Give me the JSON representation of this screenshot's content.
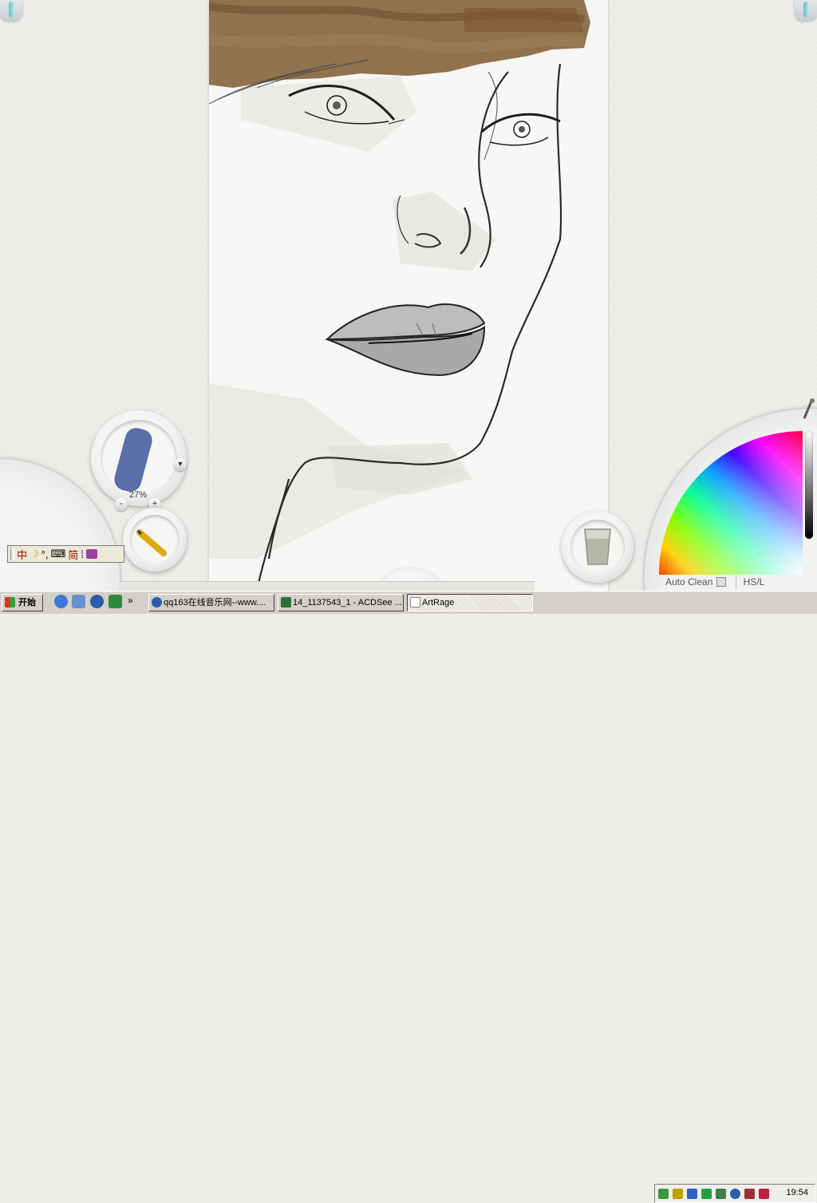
{
  "app": {
    "name": "ArtRage"
  },
  "tools": {
    "brush_size": "27%",
    "minus_label": "-",
    "plus_label": "+"
  },
  "color_picker": {
    "auto_clean_label": "Auto Clean",
    "hsl_label": "HS/L"
  },
  "ime_bar": {
    "lang": "中",
    "simplified": "简"
  },
  "taskbar": {
    "start_label": "开始",
    "chevron": "»",
    "tasks": [
      {
        "label": "qq163在线音乐网--www...."
      },
      {
        "label": "14_1137543_1 - ACDSee ..."
      },
      {
        "label": "ArtRage"
      }
    ],
    "clock": "19:54"
  },
  "colors": {
    "hair_brown": "#8a6a44",
    "brush_blue": "#5a6ea8",
    "taskbar": "#d4d0c8"
  }
}
